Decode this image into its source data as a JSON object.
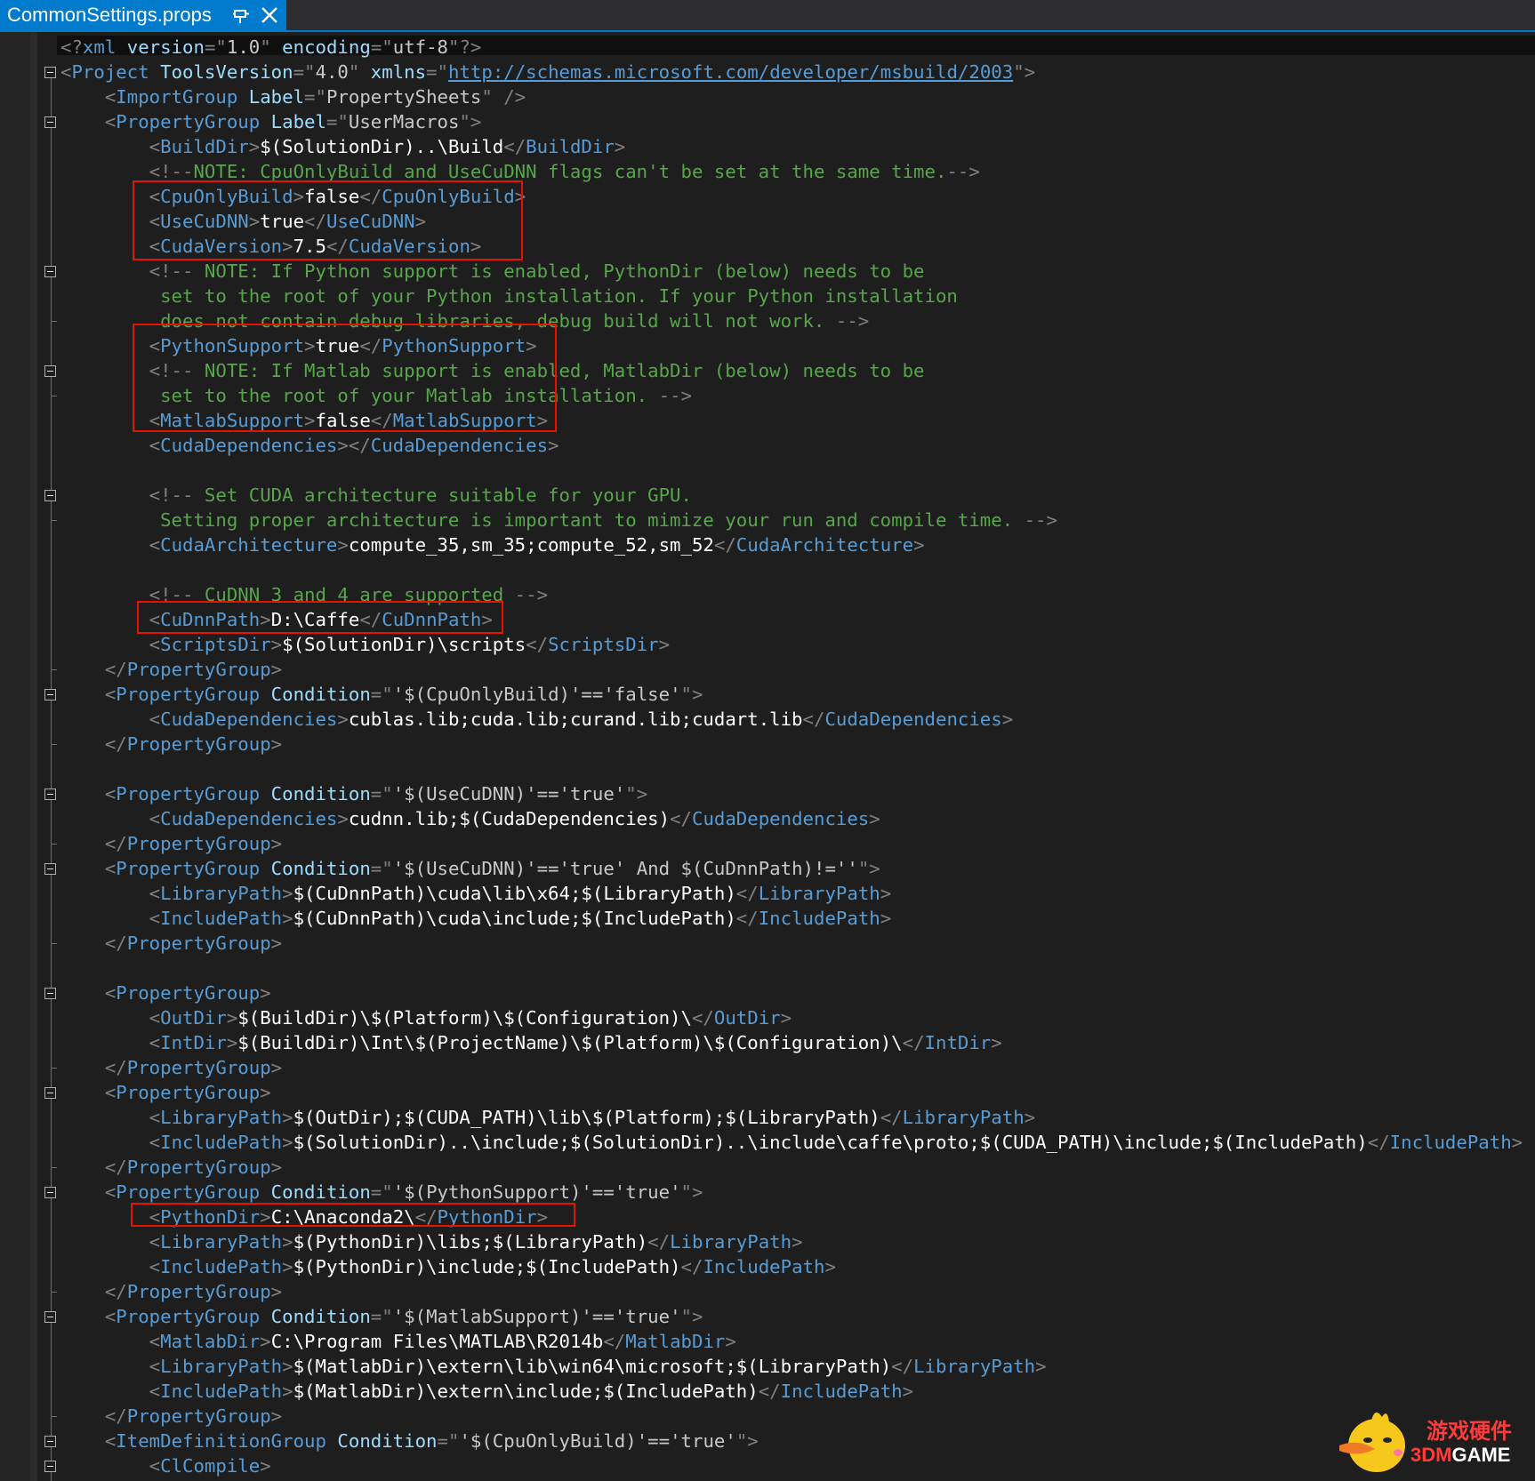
{
  "tab": {
    "title": "CommonSettings.props",
    "active_color": "#007acc",
    "pin_icon": "pin-icon",
    "close_icon": "close-icon"
  },
  "colors": {
    "editor_bg": "#1e1e1e",
    "symbol": "#808080",
    "element": "#569cd6",
    "attribute": "#9cdcfe",
    "attr_value": "#c8c8c8",
    "text": "#ffffff",
    "comment": "#57a64a",
    "highlight_box": "#e51400"
  },
  "watermark": {
    "chinese": "游戏硬件",
    "brand_prefix": "3DM",
    "brand_suffix": "GAME",
    "mascot_icon": "yellow-bird-mascot-icon"
  },
  "code_lines": [
    [
      [
        "s",
        "<?"
      ],
      [
        "e",
        "xml"
      ],
      [
        "a",
        " version"
      ],
      [
        "s",
        "=\""
      ],
      [
        "v",
        "1.0"
      ],
      [
        "s",
        "\""
      ],
      [
        "a",
        " encoding"
      ],
      [
        "s",
        "=\""
      ],
      [
        "v",
        "utf-8"
      ],
      [
        "s",
        "\"?>"
      ]
    ],
    [
      [
        "s",
        "<"
      ],
      [
        "e",
        "Project"
      ],
      [
        "a",
        " ToolsVersion"
      ],
      [
        "s",
        "=\""
      ],
      [
        "v",
        "4.0"
      ],
      [
        "s",
        "\""
      ],
      [
        "a",
        " xmlns"
      ],
      [
        "s",
        "=\""
      ],
      [
        "u",
        "http://schemas.microsoft.com/developer/msbuild/2003"
      ],
      [
        "s",
        "\">"
      ]
    ],
    [
      [
        "t",
        "    "
      ],
      [
        "s",
        "<"
      ],
      [
        "e",
        "ImportGroup"
      ],
      [
        "a",
        " Label"
      ],
      [
        "s",
        "=\""
      ],
      [
        "v",
        "PropertySheets"
      ],
      [
        "s",
        "\" />"
      ]
    ],
    [
      [
        "t",
        "    "
      ],
      [
        "s",
        "<"
      ],
      [
        "e",
        "PropertyGroup"
      ],
      [
        "a",
        " Label"
      ],
      [
        "s",
        "=\""
      ],
      [
        "v",
        "UserMacros"
      ],
      [
        "s",
        "\">"
      ]
    ],
    [
      [
        "t",
        "        "
      ],
      [
        "s",
        "<"
      ],
      [
        "e",
        "BuildDir"
      ],
      [
        "s",
        ">"
      ],
      [
        "t",
        "$(SolutionDir)..\\Build"
      ],
      [
        "s",
        "</"
      ],
      [
        "e",
        "BuildDir"
      ],
      [
        "s",
        ">"
      ]
    ],
    [
      [
        "t",
        "        "
      ],
      [
        "s",
        "<!--"
      ],
      [
        "c",
        "NOTE: CpuOnlyBuild and UseCuDNN flags can't be set at the same time."
      ],
      [
        "s",
        "-->"
      ]
    ],
    [
      [
        "t",
        "        "
      ],
      [
        "s",
        "<"
      ],
      [
        "e",
        "CpuOnlyBuild"
      ],
      [
        "s",
        ">"
      ],
      [
        "t",
        "false"
      ],
      [
        "s",
        "</"
      ],
      [
        "e",
        "CpuOnlyBuild"
      ],
      [
        "s",
        ">"
      ]
    ],
    [
      [
        "t",
        "        "
      ],
      [
        "s",
        "<"
      ],
      [
        "e",
        "UseCuDNN"
      ],
      [
        "s",
        ">"
      ],
      [
        "t",
        "true"
      ],
      [
        "s",
        "</"
      ],
      [
        "e",
        "UseCuDNN"
      ],
      [
        "s",
        ">"
      ]
    ],
    [
      [
        "t",
        "        "
      ],
      [
        "s",
        "<"
      ],
      [
        "e",
        "CudaVersion"
      ],
      [
        "s",
        ">"
      ],
      [
        "t",
        "7.5"
      ],
      [
        "s",
        "</"
      ],
      [
        "e",
        "CudaVersion"
      ],
      [
        "s",
        ">"
      ]
    ],
    [
      [
        "t",
        "        "
      ],
      [
        "s",
        "<!--"
      ],
      [
        "c",
        " NOTE: If Python support is enabled, PythonDir (below) needs to be"
      ]
    ],
    [
      [
        "c",
        "         set to the root of your Python installation. If your Python installation"
      ]
    ],
    [
      [
        "c",
        "         does not contain debug libraries, debug build will not work. "
      ],
      [
        "s",
        "-->"
      ]
    ],
    [
      [
        "t",
        "        "
      ],
      [
        "s",
        "<"
      ],
      [
        "e",
        "PythonSupport"
      ],
      [
        "s",
        ">"
      ],
      [
        "t",
        "true"
      ],
      [
        "s",
        "</"
      ],
      [
        "e",
        "PythonSupport"
      ],
      [
        "s",
        ">"
      ]
    ],
    [
      [
        "t",
        "        "
      ],
      [
        "s",
        "<!--"
      ],
      [
        "c",
        " NOTE: If Matlab support is enabled, MatlabDir (below) needs to be"
      ]
    ],
    [
      [
        "c",
        "         set to the root of your Matlab installation. "
      ],
      [
        "s",
        "-->"
      ]
    ],
    [
      [
        "t",
        "        "
      ],
      [
        "s",
        "<"
      ],
      [
        "e",
        "MatlabSupport"
      ],
      [
        "s",
        ">"
      ],
      [
        "t",
        "false"
      ],
      [
        "s",
        "</"
      ],
      [
        "e",
        "MatlabSupport"
      ],
      [
        "s",
        ">"
      ]
    ],
    [
      [
        "t",
        "        "
      ],
      [
        "s",
        "<"
      ],
      [
        "e",
        "CudaDependencies"
      ],
      [
        "s",
        "></"
      ],
      [
        "e",
        "CudaDependencies"
      ],
      [
        "s",
        ">"
      ]
    ],
    [],
    [
      [
        "t",
        "        "
      ],
      [
        "s",
        "<!--"
      ],
      [
        "c",
        " Set CUDA architecture suitable for your GPU."
      ]
    ],
    [
      [
        "c",
        "         Setting proper architecture is important to mimize your run and compile time. "
      ],
      [
        "s",
        "-->"
      ]
    ],
    [
      [
        "t",
        "        "
      ],
      [
        "s",
        "<"
      ],
      [
        "e",
        "CudaArchitecture"
      ],
      [
        "s",
        ">"
      ],
      [
        "t",
        "compute_35,sm_35;compute_52,sm_52"
      ],
      [
        "s",
        "</"
      ],
      [
        "e",
        "CudaArchitecture"
      ],
      [
        "s",
        ">"
      ]
    ],
    [],
    [
      [
        "t",
        "        "
      ],
      [
        "s",
        "<!--"
      ],
      [
        "c",
        " CuDNN 3 and 4 are supported "
      ],
      [
        "s",
        "-->"
      ]
    ],
    [
      [
        "t",
        "        "
      ],
      [
        "s",
        "<"
      ],
      [
        "e",
        "CuDnnPath"
      ],
      [
        "s",
        ">"
      ],
      [
        "t",
        "D:\\Caffe"
      ],
      [
        "s",
        "</"
      ],
      [
        "e",
        "CuDnnPath"
      ],
      [
        "s",
        ">"
      ]
    ],
    [
      [
        "t",
        "        "
      ],
      [
        "s",
        "<"
      ],
      [
        "e",
        "ScriptsDir"
      ],
      [
        "s",
        ">"
      ],
      [
        "t",
        "$(SolutionDir)\\scripts"
      ],
      [
        "s",
        "</"
      ],
      [
        "e",
        "ScriptsDir"
      ],
      [
        "s",
        ">"
      ]
    ],
    [
      [
        "t",
        "    "
      ],
      [
        "s",
        "</"
      ],
      [
        "e",
        "PropertyGroup"
      ],
      [
        "s",
        ">"
      ]
    ],
    [
      [
        "t",
        "    "
      ],
      [
        "s",
        "<"
      ],
      [
        "e",
        "PropertyGroup"
      ],
      [
        "a",
        " Condition"
      ],
      [
        "s",
        "=\""
      ],
      [
        "v",
        "'$(CpuOnlyBuild)'=='false'"
      ],
      [
        "s",
        "\">"
      ]
    ],
    [
      [
        "t",
        "        "
      ],
      [
        "s",
        "<"
      ],
      [
        "e",
        "CudaDependencies"
      ],
      [
        "s",
        ">"
      ],
      [
        "t",
        "cublas.lib;cuda.lib;curand.lib;cudart.lib"
      ],
      [
        "s",
        "</"
      ],
      [
        "e",
        "CudaDependencies"
      ],
      [
        "s",
        ">"
      ]
    ],
    [
      [
        "t",
        "    "
      ],
      [
        "s",
        "</"
      ],
      [
        "e",
        "PropertyGroup"
      ],
      [
        "s",
        ">"
      ]
    ],
    [],
    [
      [
        "t",
        "    "
      ],
      [
        "s",
        "<"
      ],
      [
        "e",
        "PropertyGroup"
      ],
      [
        "a",
        " Condition"
      ],
      [
        "s",
        "=\""
      ],
      [
        "v",
        "'$(UseCuDNN)'=='true'"
      ],
      [
        "s",
        "\">"
      ]
    ],
    [
      [
        "t",
        "        "
      ],
      [
        "s",
        "<"
      ],
      [
        "e",
        "CudaDependencies"
      ],
      [
        "s",
        ">"
      ],
      [
        "t",
        "cudnn.lib;$(CudaDependencies)"
      ],
      [
        "s",
        "</"
      ],
      [
        "e",
        "CudaDependencies"
      ],
      [
        "s",
        ">"
      ]
    ],
    [
      [
        "t",
        "    "
      ],
      [
        "s",
        "</"
      ],
      [
        "e",
        "PropertyGroup"
      ],
      [
        "s",
        ">"
      ]
    ],
    [
      [
        "t",
        "    "
      ],
      [
        "s",
        "<"
      ],
      [
        "e",
        "PropertyGroup"
      ],
      [
        "a",
        " Condition"
      ],
      [
        "s",
        "=\""
      ],
      [
        "v",
        "'$(UseCuDNN)'=='true' And $(CuDnnPath)!=''"
      ],
      [
        "s",
        "\">"
      ]
    ],
    [
      [
        "t",
        "        "
      ],
      [
        "s",
        "<"
      ],
      [
        "e",
        "LibraryPath"
      ],
      [
        "s",
        ">"
      ],
      [
        "t",
        "$(CuDnnPath)\\cuda\\lib\\x64;$(LibraryPath)"
      ],
      [
        "s",
        "</"
      ],
      [
        "e",
        "LibraryPath"
      ],
      [
        "s",
        ">"
      ]
    ],
    [
      [
        "t",
        "        "
      ],
      [
        "s",
        "<"
      ],
      [
        "e",
        "IncludePath"
      ],
      [
        "s",
        ">"
      ],
      [
        "t",
        "$(CuDnnPath)\\cuda\\include;$(IncludePath)"
      ],
      [
        "s",
        "</"
      ],
      [
        "e",
        "IncludePath"
      ],
      [
        "s",
        ">"
      ]
    ],
    [
      [
        "t",
        "    "
      ],
      [
        "s",
        "</"
      ],
      [
        "e",
        "PropertyGroup"
      ],
      [
        "s",
        ">"
      ]
    ],
    [],
    [
      [
        "t",
        "    "
      ],
      [
        "s",
        "<"
      ],
      [
        "e",
        "PropertyGroup"
      ],
      [
        "s",
        ">"
      ]
    ],
    [
      [
        "t",
        "        "
      ],
      [
        "s",
        "<"
      ],
      [
        "e",
        "OutDir"
      ],
      [
        "s",
        ">"
      ],
      [
        "t",
        "$(BuildDir)\\$(Platform)\\$(Configuration)\\"
      ],
      [
        "s",
        "</"
      ],
      [
        "e",
        "OutDir"
      ],
      [
        "s",
        ">"
      ]
    ],
    [
      [
        "t",
        "        "
      ],
      [
        "s",
        "<"
      ],
      [
        "e",
        "IntDir"
      ],
      [
        "s",
        ">"
      ],
      [
        "t",
        "$(BuildDir)\\Int\\$(ProjectName)\\$(Platform)\\$(Configuration)\\"
      ],
      [
        "s",
        "</"
      ],
      [
        "e",
        "IntDir"
      ],
      [
        "s",
        ">"
      ]
    ],
    [
      [
        "t",
        "    "
      ],
      [
        "s",
        "</"
      ],
      [
        "e",
        "PropertyGroup"
      ],
      [
        "s",
        ">"
      ]
    ],
    [
      [
        "t",
        "    "
      ],
      [
        "s",
        "<"
      ],
      [
        "e",
        "PropertyGroup"
      ],
      [
        "s",
        ">"
      ]
    ],
    [
      [
        "t",
        "        "
      ],
      [
        "s",
        "<"
      ],
      [
        "e",
        "LibraryPath"
      ],
      [
        "s",
        ">"
      ],
      [
        "t",
        "$(OutDir);$(CUDA_PATH)\\lib\\$(Platform);$(LibraryPath)"
      ],
      [
        "s",
        "</"
      ],
      [
        "e",
        "LibraryPath"
      ],
      [
        "s",
        ">"
      ]
    ],
    [
      [
        "t",
        "        "
      ],
      [
        "s",
        "<"
      ],
      [
        "e",
        "IncludePath"
      ],
      [
        "s",
        ">"
      ],
      [
        "t",
        "$(SolutionDir)..\\include;$(SolutionDir)..\\include\\caffe\\proto;$(CUDA_PATH)\\include;$(IncludePath)"
      ],
      [
        "s",
        "</"
      ],
      [
        "e",
        "IncludePath"
      ],
      [
        "s",
        ">"
      ]
    ],
    [
      [
        "t",
        "    "
      ],
      [
        "s",
        "</"
      ],
      [
        "e",
        "PropertyGroup"
      ],
      [
        "s",
        ">"
      ]
    ],
    [
      [
        "t",
        "    "
      ],
      [
        "s",
        "<"
      ],
      [
        "e",
        "PropertyGroup"
      ],
      [
        "a",
        " Condition"
      ],
      [
        "s",
        "=\""
      ],
      [
        "v",
        "'$(PythonSupport)'=='true'"
      ],
      [
        "s",
        "\">"
      ]
    ],
    [
      [
        "t",
        "        "
      ],
      [
        "s",
        "<"
      ],
      [
        "e",
        "PythonDir"
      ],
      [
        "s",
        ">"
      ],
      [
        "t",
        "C:\\Anaconda2\\"
      ],
      [
        "s",
        "</"
      ],
      [
        "e",
        "PythonDir"
      ],
      [
        "s",
        ">"
      ]
    ],
    [
      [
        "t",
        "        "
      ],
      [
        "s",
        "<"
      ],
      [
        "e",
        "LibraryPath"
      ],
      [
        "s",
        ">"
      ],
      [
        "t",
        "$(PythonDir)\\libs;$(LibraryPath)"
      ],
      [
        "s",
        "</"
      ],
      [
        "e",
        "LibraryPath"
      ],
      [
        "s",
        ">"
      ]
    ],
    [
      [
        "t",
        "        "
      ],
      [
        "s",
        "<"
      ],
      [
        "e",
        "IncludePath"
      ],
      [
        "s",
        ">"
      ],
      [
        "t",
        "$(PythonDir)\\include;$(IncludePath)"
      ],
      [
        "s",
        "</"
      ],
      [
        "e",
        "IncludePath"
      ],
      [
        "s",
        ">"
      ]
    ],
    [
      [
        "t",
        "    "
      ],
      [
        "s",
        "</"
      ],
      [
        "e",
        "PropertyGroup"
      ],
      [
        "s",
        ">"
      ]
    ],
    [
      [
        "t",
        "    "
      ],
      [
        "s",
        "<"
      ],
      [
        "e",
        "PropertyGroup"
      ],
      [
        "a",
        " Condition"
      ],
      [
        "s",
        "=\""
      ],
      [
        "v",
        "'$(MatlabSupport)'=='true'"
      ],
      [
        "s",
        "\">"
      ]
    ],
    [
      [
        "t",
        "        "
      ],
      [
        "s",
        "<"
      ],
      [
        "e",
        "MatlabDir"
      ],
      [
        "s",
        ">"
      ],
      [
        "t",
        "C:\\Program Files\\MATLAB\\R2014b"
      ],
      [
        "s",
        "</"
      ],
      [
        "e",
        "MatlabDir"
      ],
      [
        "s",
        ">"
      ]
    ],
    [
      [
        "t",
        "        "
      ],
      [
        "s",
        "<"
      ],
      [
        "e",
        "LibraryPath"
      ],
      [
        "s",
        ">"
      ],
      [
        "t",
        "$(MatlabDir)\\extern\\lib\\win64\\microsoft;$(LibraryPath)"
      ],
      [
        "s",
        "</"
      ],
      [
        "e",
        "LibraryPath"
      ],
      [
        "s",
        ">"
      ]
    ],
    [
      [
        "t",
        "        "
      ],
      [
        "s",
        "<"
      ],
      [
        "e",
        "IncludePath"
      ],
      [
        "s",
        ">"
      ],
      [
        "t",
        "$(MatlabDir)\\extern\\include;$(IncludePath)"
      ],
      [
        "s",
        "</"
      ],
      [
        "e",
        "IncludePath"
      ],
      [
        "s",
        ">"
      ]
    ],
    [
      [
        "t",
        "    "
      ],
      [
        "s",
        "</"
      ],
      [
        "e",
        "PropertyGroup"
      ],
      [
        "s",
        ">"
      ]
    ],
    [
      [
        "t",
        "    "
      ],
      [
        "s",
        "<"
      ],
      [
        "e",
        "ItemDefinitionGroup"
      ],
      [
        "a",
        " Condition"
      ],
      [
        "s",
        "=\""
      ],
      [
        "v",
        "'$(CpuOnlyBuild)'=='true'"
      ],
      [
        "s",
        "\">"
      ]
    ],
    [
      [
        "t",
        "        "
      ],
      [
        "s",
        "<"
      ],
      [
        "e",
        "ClCompile"
      ],
      [
        "s",
        ">"
      ]
    ]
  ]
}
